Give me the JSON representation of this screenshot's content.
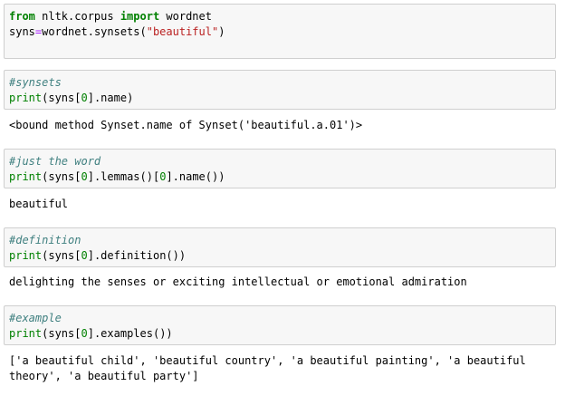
{
  "cells": [
    {
      "lines": [
        [
          "from",
          " nltk.corpus ",
          "import",
          " wordnet"
        ],
        [
          "syns",
          "=",
          "wordnet.synsets(",
          "\"beautiful\"",
          ")"
        ]
      ]
    },
    {
      "comment": "#synsets",
      "code": [
        "print",
        "(syns[",
        "0",
        "].name)"
      ],
      "output": "<bound method Synset.name of Synset('beautiful.a.01')>"
    },
    {
      "comment": "#just the word",
      "code": [
        "print",
        "(syns[",
        "0",
        "].lemmas()[",
        "0",
        "].name())"
      ],
      "output": "beautiful"
    },
    {
      "comment": "#definition",
      "code": [
        "print",
        "(syns[",
        "0",
        "].definition())"
      ],
      "output": "delighting the senses or exciting intellectual or emotional admiration"
    },
    {
      "comment": "#example",
      "code": [
        "print",
        "(syns[",
        "0",
        "].examples())"
      ],
      "output_lines": [
        "['a beautiful child', 'beautiful country', 'a beautiful painting', 'a beautiful",
        "theory', 'a beautiful party']"
      ]
    }
  ]
}
